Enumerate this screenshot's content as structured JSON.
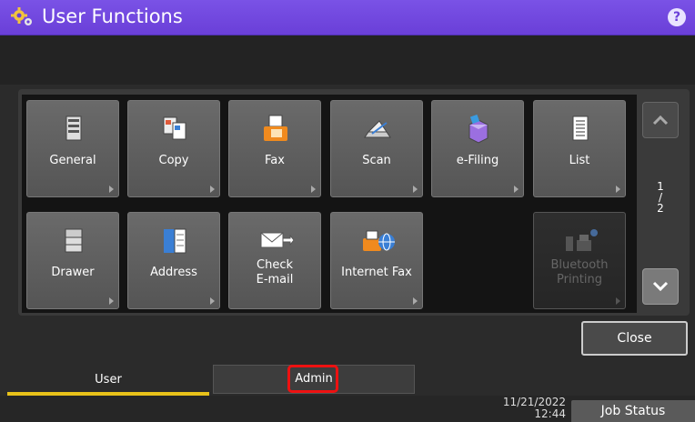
{
  "header": {
    "title": "User Functions",
    "icon": "gear-icon",
    "help_icon": "question-icon",
    "help_glyph": "?"
  },
  "tiles": [
    {
      "label": "General",
      "icon": "general-settings-icon",
      "enabled": true
    },
    {
      "label": "Copy",
      "icon": "copy-icon",
      "enabled": true
    },
    {
      "label": "Fax",
      "icon": "fax-icon",
      "enabled": true
    },
    {
      "label": "Scan",
      "icon": "scan-icon",
      "enabled": true
    },
    {
      "label": "e-Filing",
      "icon": "e-filing-icon",
      "enabled": true
    },
    {
      "label": "List",
      "icon": "list-icon",
      "enabled": true
    },
    {
      "label": "Drawer",
      "icon": "drawer-icon",
      "enabled": true
    },
    {
      "label": "Address",
      "icon": "address-book-icon",
      "enabled": true
    },
    {
      "label": "Check E-mail",
      "line1": "Check",
      "line2": "E-mail",
      "icon": "email-icon",
      "enabled": true
    },
    {
      "label": "Internet Fax",
      "icon": "internet-fax-icon",
      "enabled": true
    },
    {
      "label": "Bluetooth Printing",
      "line1": "Bluetooth",
      "line2": "Printing",
      "icon": "bluetooth-printing-icon",
      "enabled": false
    }
  ],
  "pagination": {
    "current": "1",
    "separator": "/",
    "total": "2"
  },
  "buttons": {
    "close": "Close",
    "job_status": "Job Status"
  },
  "tabs": {
    "user": "User",
    "admin": "Admin",
    "active": "User"
  },
  "status": {
    "date": "11/21/2022",
    "time": "12:44"
  },
  "colors": {
    "title_bar": "#6a3fd8",
    "active_tab_underline": "#e8c21a",
    "highlight_box": "#ee1111"
  }
}
